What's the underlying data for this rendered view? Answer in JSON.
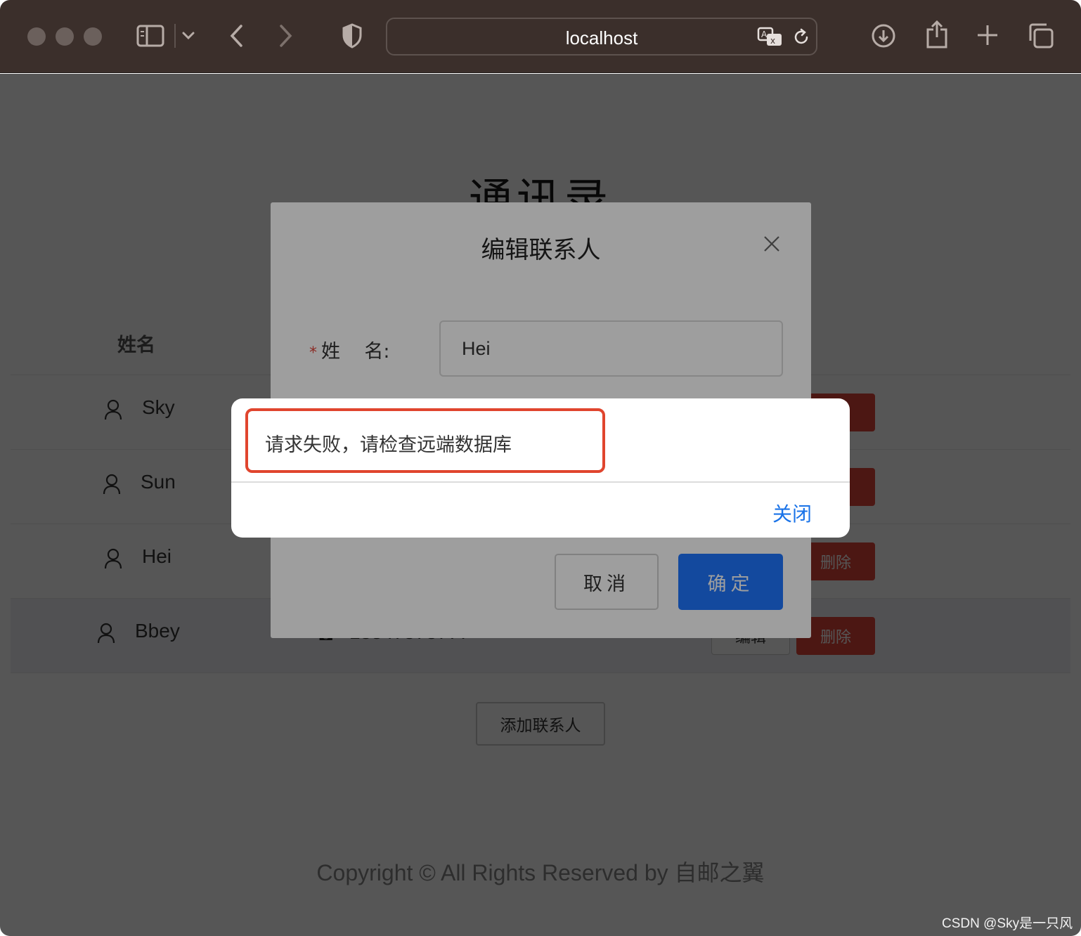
{
  "browser": {
    "url": "localhost",
    "colors": {
      "toolbar": "#3b2f2b",
      "traffic_light": "#6b605c"
    },
    "icons": [
      "sidebar-icon",
      "chevron-down-icon",
      "back-icon",
      "forward-icon",
      "shield-icon",
      "translate-icon",
      "reload-icon",
      "download-icon",
      "share-icon",
      "new-tab-icon",
      "tabs-overview-icon"
    ]
  },
  "page": {
    "title": "通讯录",
    "column_header": "姓名",
    "rows": [
      {
        "name": "Sky",
        "phone": "",
        "edit_label": "",
        "delete_label": ""
      },
      {
        "name": "Sun",
        "phone": "",
        "edit_label": "",
        "delete_label": ""
      },
      {
        "name": "Hei",
        "phone": "",
        "edit_label": "",
        "delete_label": "删除"
      },
      {
        "name": "Bbey",
        "phone": "13847578777",
        "edit_label": "编辑",
        "delete_label": "删除"
      }
    ],
    "add_button": "添加联系人",
    "copyright": "Copyright © All Rights Reserved by 自邮之翼"
  },
  "modal": {
    "title": "编辑联系人",
    "required_mark": "*",
    "name_label": "姓    名:",
    "name_value": "Hei",
    "cancel_label": "取消",
    "ok_label": "确定",
    "colors": {
      "primary": "#1f77ff",
      "danger": "#e0463b"
    }
  },
  "alert": {
    "message": "请求失败，请检查远端数据库",
    "close_label": "关闭",
    "colors": {
      "highlight": "#e0452e",
      "link": "#1a73e8"
    }
  },
  "watermark": "CSDN @Sky是一只风"
}
